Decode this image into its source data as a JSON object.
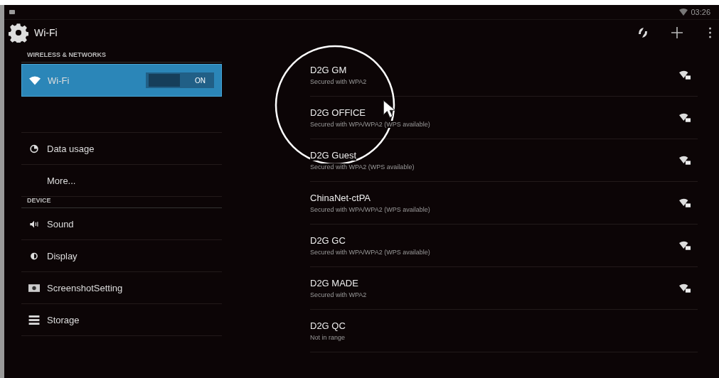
{
  "status_bar": {
    "time": "03:26"
  },
  "action_bar": {
    "title": "Wi-Fi"
  },
  "sidebar": {
    "sections": [
      {
        "header": "WIRELESS & NETWORKS",
        "items": [
          {
            "kind": "toggle",
            "label": "Wi-Fi",
            "selected": true,
            "switch": {
              "on": true,
              "label": "ON"
            }
          },
          {
            "kind": "spacer"
          },
          {
            "kind": "item",
            "label": "Data usage",
            "selected": false
          },
          {
            "kind": "item",
            "label": "More...",
            "selected": false
          }
        ]
      },
      {
        "header": "DEVICE",
        "items": [
          {
            "kind": "item",
            "label": "Sound",
            "selected": false
          },
          {
            "kind": "item",
            "label": "Display",
            "selected": false
          },
          {
            "kind": "item",
            "label": "ScreenshotSetting",
            "selected": false
          },
          {
            "kind": "item",
            "label": "Storage",
            "selected": false
          }
        ]
      }
    ]
  },
  "networks": [
    {
      "name": "D2G GM",
      "status": "Secured with WPA2",
      "in_range": true
    },
    {
      "name": "D2G OFFICE",
      "status": "Secured with WPA/WPA2 (WPS available)",
      "in_range": true
    },
    {
      "name": "D2G Guest",
      "status": "Secured with WPA2 (WPS available)",
      "in_range": true
    },
    {
      "name": "ChinaNet-ctPA",
      "status": "Secured with WPA/WPA2 (WPS available)",
      "in_range": true
    },
    {
      "name": "D2G GC",
      "status": "Secured with WPA/WPA2 (WPS available)",
      "in_range": true
    },
    {
      "name": "D2G MADE",
      "status": "Secured with WPA2",
      "in_range": true
    },
    {
      "name": "D2G QC",
      "status": "Not in range",
      "in_range": false
    }
  ]
}
